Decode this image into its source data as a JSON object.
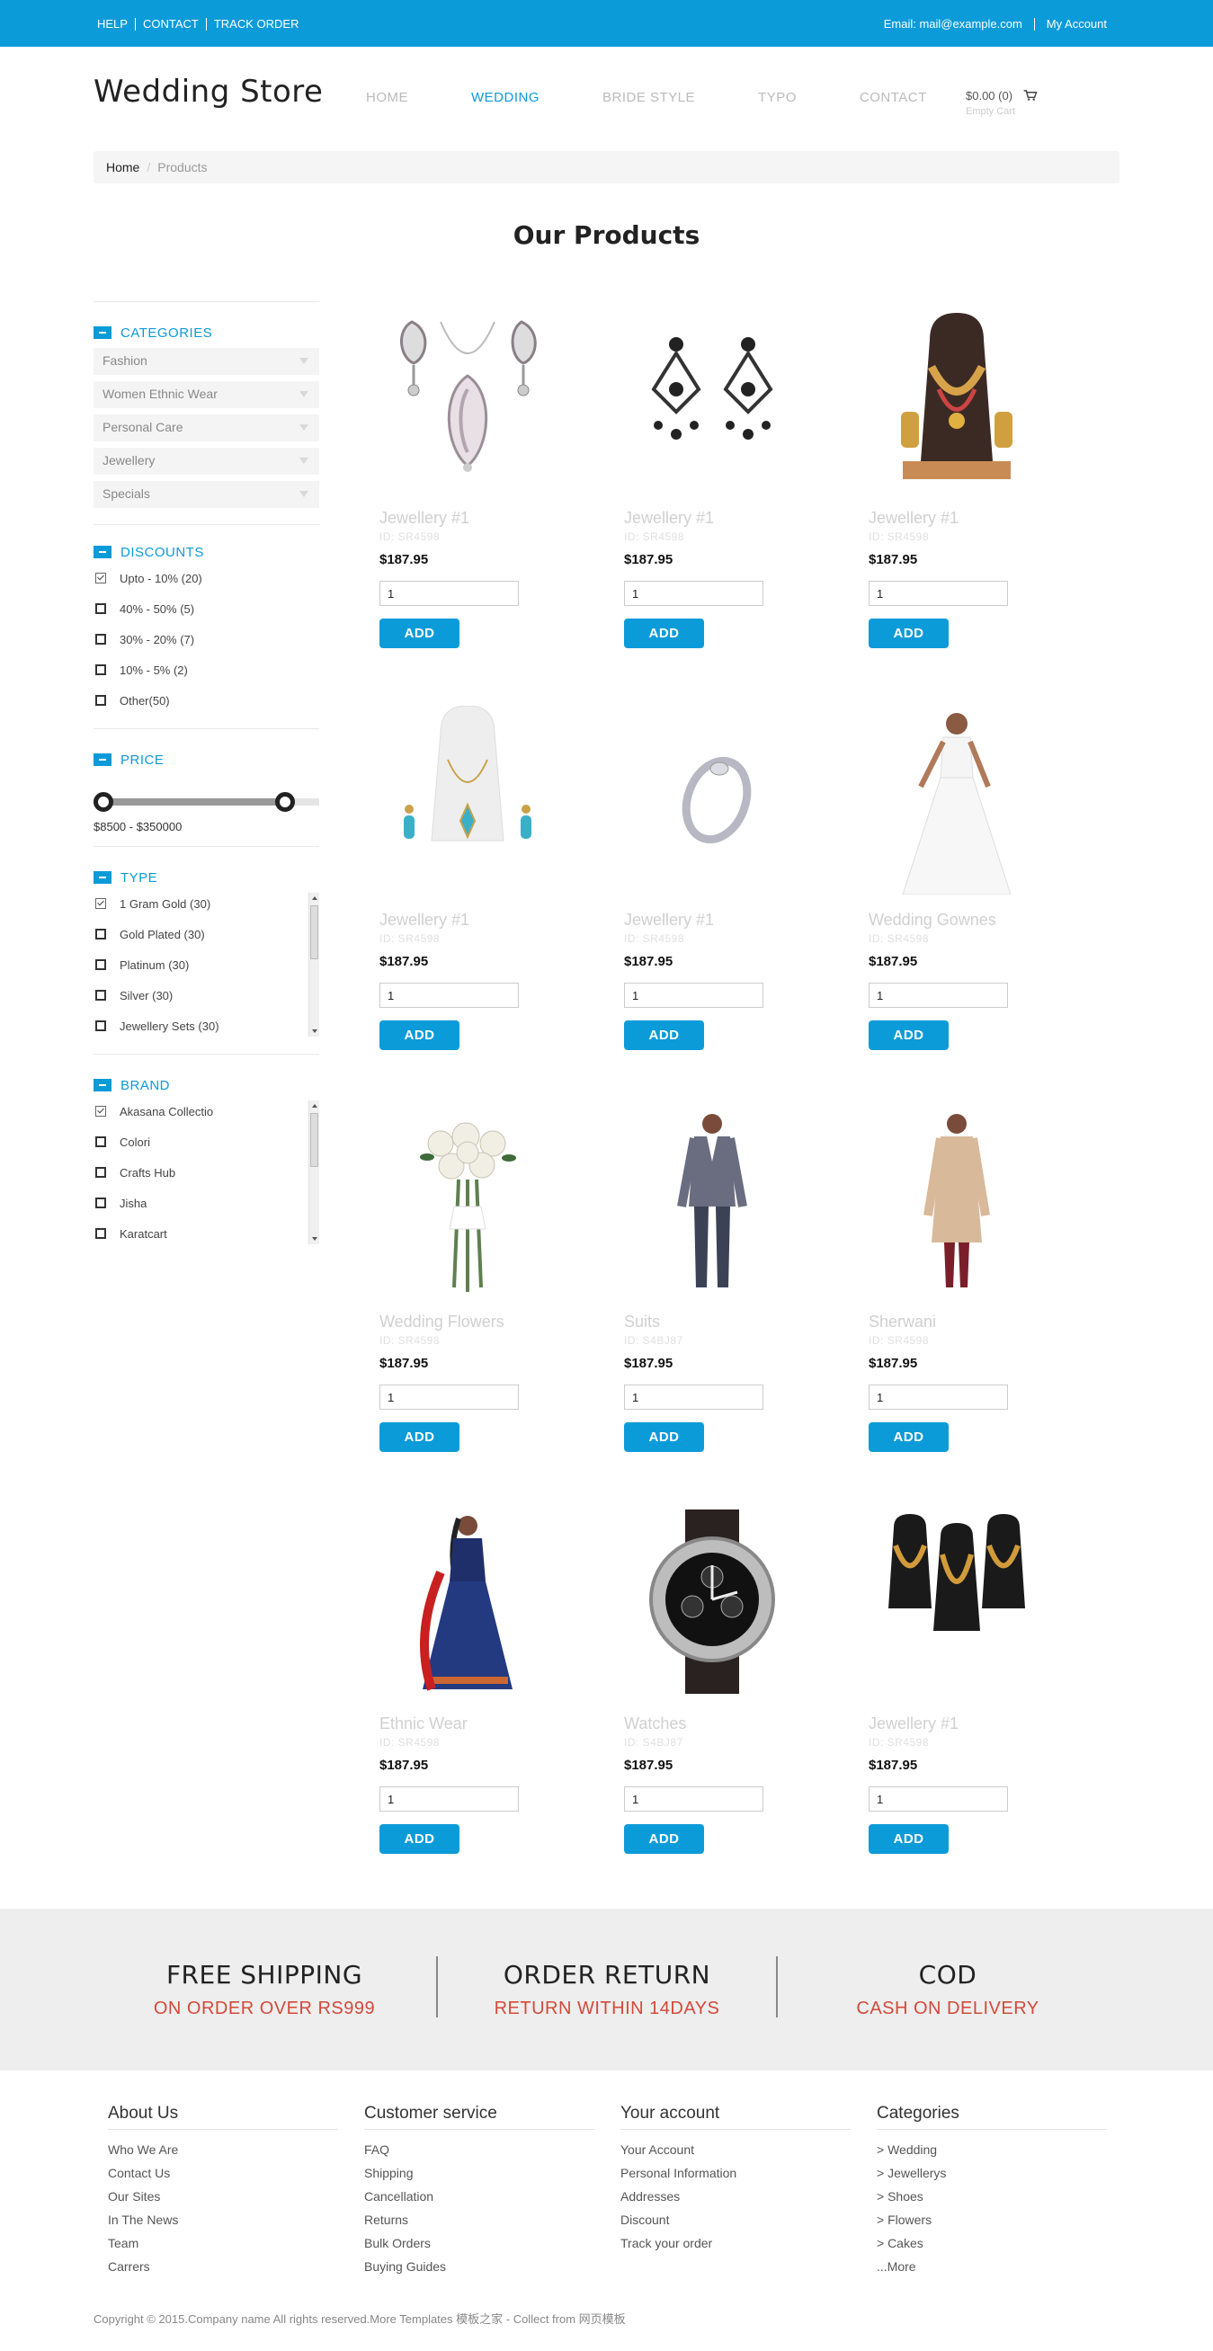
{
  "topbar": {
    "links": [
      "HELP",
      "CONTACT",
      "TRACK ORDER"
    ],
    "email": "Email: mail@example.com",
    "account": "My Account"
  },
  "header": {
    "logo": "Wedding Store",
    "nav": [
      "HOME",
      "WEDDING",
      "BRIDE STYLE",
      "TYPO",
      "CONTACT"
    ],
    "active_nav": "WEDDING",
    "cart_total": "$0.00 (0)",
    "cart_status": "Empty Cart"
  },
  "breadcrumb": {
    "home": "Home",
    "divider": "/",
    "current": "Products"
  },
  "page_title": "Our Products",
  "sidebar": {
    "categories": {
      "title": "CATEGORIES",
      "items": [
        "Fashion",
        "Women Ethnic Wear",
        "Personal Care",
        "Jewellery",
        "Specials"
      ]
    },
    "discounts": {
      "title": "DISCOUNTS",
      "items": [
        {
          "label": "Upto - 10% (20)",
          "checked": true
        },
        {
          "label": "40% - 50% (5)",
          "checked": false
        },
        {
          "label": "30% - 20% (7)",
          "checked": false
        },
        {
          "label": "10% - 5% (2)",
          "checked": false
        },
        {
          "label": "Other(50)",
          "checked": false
        }
      ]
    },
    "price": {
      "title": "PRICE",
      "range_label": "$8500 - $350000",
      "min_handle_fraction": 0.0,
      "max_handle_fraction": 0.88
    },
    "type": {
      "title": "TYPE",
      "items": [
        {
          "label": "1 Gram Gold (30)",
          "checked": true
        },
        {
          "label": "Gold Plated (30)",
          "checked": false
        },
        {
          "label": "Platinum (30)",
          "checked": false
        },
        {
          "label": "Silver (30)",
          "checked": false
        },
        {
          "label": "Jewellery Sets (30)",
          "checked": false
        }
      ]
    },
    "brand": {
      "title": "BRAND",
      "items": [
        {
          "label": "Akasana Collectio",
          "checked": true
        },
        {
          "label": "Colori",
          "checked": false
        },
        {
          "label": "Crafts Hub",
          "checked": false
        },
        {
          "label": "Jisha",
          "checked": false
        },
        {
          "label": "Karatcart",
          "checked": false
        }
      ]
    }
  },
  "products": [
    {
      "name": "Jewellery #1",
      "id": "ID: SR4598",
      "price": "$187.95",
      "qty": "1",
      "add": "ADD",
      "image": "necklace-set-icon"
    },
    {
      "name": "Jewellery #1",
      "id": "ID: SR4598",
      "price": "$187.95",
      "qty": "1",
      "add": "ADD",
      "image": "earrings-icon"
    },
    {
      "name": "Jewellery #1",
      "id": "ID: SR4598",
      "price": "$187.95",
      "qty": "1",
      "add": "ADD",
      "image": "bridal-necklace-icon"
    },
    {
      "name": "Jewellery #1",
      "id": "ID: SR4598",
      "price": "$187.95",
      "qty": "1",
      "add": "ADD",
      "image": "pendant-set-icon"
    },
    {
      "name": "Jewellery #1",
      "id": "ID: SR4598",
      "price": "$187.95",
      "qty": "1",
      "add": "ADD",
      "image": "ring-icon"
    },
    {
      "name": "Wedding Gownes",
      "id": "ID: SR4598",
      "price": "$187.95",
      "qty": "1",
      "add": "ADD",
      "image": "wedding-gown-icon"
    },
    {
      "name": "Wedding Flowers",
      "id": "ID: SR4598",
      "price": "$187.95",
      "qty": "1",
      "add": "ADD",
      "image": "bouquet-icon"
    },
    {
      "name": "Suits",
      "id": "ID: S4BJ87",
      "price": "$187.95",
      "qty": "1",
      "add": "ADD",
      "image": "suit-icon"
    },
    {
      "name": "Sherwani",
      "id": "ID: SR4598",
      "price": "$187.95",
      "qty": "1",
      "add": "ADD",
      "image": "sherwani-icon"
    },
    {
      "name": "Ethnic Wear",
      "id": "ID: SR4598",
      "price": "$187.95",
      "qty": "1",
      "add": "ADD",
      "image": "ethnic-dress-icon"
    },
    {
      "name": "Watches",
      "id": "ID: S4BJ87",
      "price": "$187.95",
      "qty": "1",
      "add": "ADD",
      "image": "watch-icon"
    },
    {
      "name": "Jewellery #1",
      "id": "ID: SR4598",
      "price": "$187.95",
      "qty": "1",
      "add": "ADD",
      "image": "jewellery-display-icon"
    }
  ],
  "features": [
    {
      "title": "FREE SHIPPING",
      "subtitle": "ON ORDER OVER RS999"
    },
    {
      "title": "ORDER RETURN",
      "subtitle": "RETURN WITHIN 14DAYS"
    },
    {
      "title": "COD",
      "subtitle": "CASH ON DELIVERY"
    }
  ],
  "footer": {
    "columns": [
      {
        "title": "About Us",
        "links": [
          "Who We Are",
          "Contact Us",
          "Our Sites",
          "In The News",
          "Team",
          "Carrers"
        ]
      },
      {
        "title": "Customer service",
        "links": [
          "FAQ",
          "Shipping",
          "Cancellation",
          "Returns",
          "Bulk Orders",
          "Buying Guides"
        ]
      },
      {
        "title": "Your account",
        "links": [
          "Your Account",
          "Personal Information",
          "Addresses",
          "Discount",
          "Track your order"
        ]
      },
      {
        "title": "Categories",
        "links": [
          "> Wedding",
          "> Jewellerys",
          "> Shoes",
          "> Flowers",
          "> Cakes",
          "...More"
        ]
      }
    ],
    "copyright": "Copyright © 2015.Company name All rights reserved.More Templates 模板之家 - Collect from 网页模板"
  },
  "colors": {
    "accent": "#0c9bd9",
    "feature_subtitle": "#d24a3a",
    "band": "#eeeeee"
  }
}
